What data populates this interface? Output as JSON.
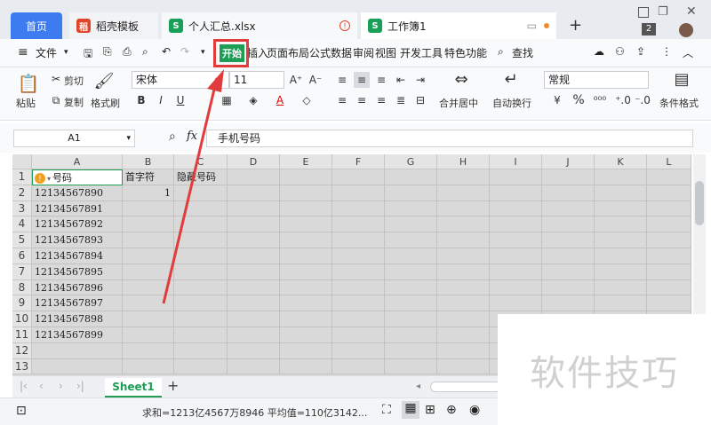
{
  "tabs": {
    "home": "首页",
    "daoke": "稻壳模板",
    "summary": "个人汇总.xlsx",
    "workbook": "工作簿1",
    "count": "2"
  },
  "menu": {
    "file": "文件",
    "start": "开始",
    "insert": "插入",
    "page_layout": "页面布局",
    "formula": "公式",
    "data": "数据",
    "review": "审阅",
    "view": "视图",
    "dev_tools": "开发工具",
    "special": "特色功能",
    "search": "查找"
  },
  "ribbon": {
    "paste": "粘贴",
    "cut": "剪切",
    "copy": "复制",
    "format_painter": "格式刷",
    "font": "宋体",
    "font_size": "11",
    "merge_center": "合并居中",
    "wrap_text": "自动换行",
    "number_format": "常规",
    "cond_format": "条件格式",
    "bold": "B",
    "italic": "I",
    "underline": "U",
    "inc_font": "A⁺",
    "dec_font": "A⁻",
    "font_color": "A",
    "percent": "%"
  },
  "formula_bar": {
    "cell_ref": "A1",
    "fx": "fx",
    "content": "手机号码"
  },
  "sheet": {
    "columns": [
      "A",
      "B",
      "C",
      "D",
      "E",
      "F",
      "G",
      "H",
      "I",
      "J",
      "K",
      "L"
    ],
    "rows": [
      "1",
      "2",
      "3",
      "4",
      "5",
      "6",
      "7",
      "8",
      "9",
      "10",
      "11",
      "12",
      "13"
    ],
    "header": {
      "a": "号码",
      "b": "首字符",
      "c": "隐藏号码"
    },
    "b2": "1",
    "numbers": [
      "12134567890",
      "12134567891",
      "12134567892",
      "12134567893",
      "12134567894",
      "12134567895",
      "12134567896",
      "12134567897",
      "12134567898",
      "12134567899"
    ]
  },
  "sheet_tab": "Sheet1",
  "status": {
    "summary": "求和=1213亿4567万8946  平均值=110亿3142..."
  },
  "watermark": "软件技巧",
  "colors": {
    "accent": "#1f9d55",
    "highlight": "#e23b3b",
    "home_tab": "#3d7bf0"
  }
}
